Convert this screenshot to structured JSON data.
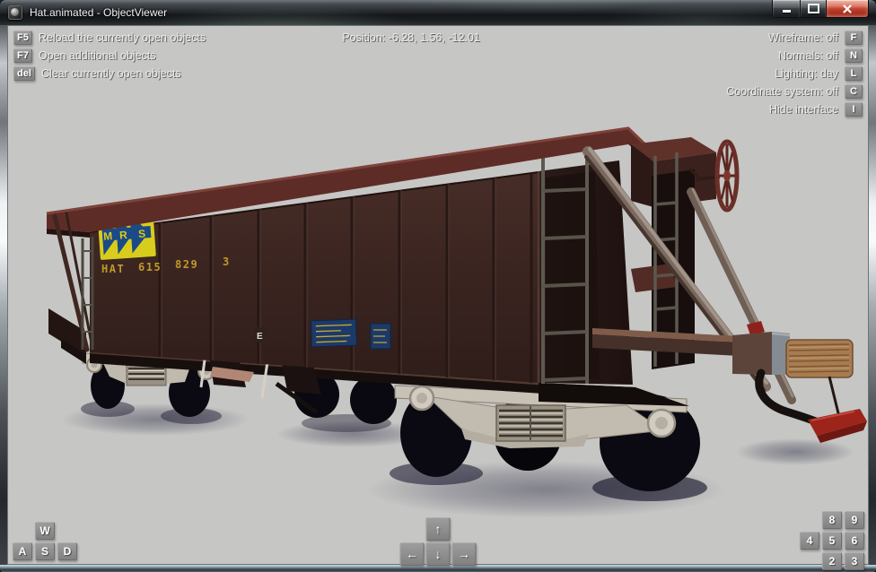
{
  "window": {
    "title": "Hat.animated - ObjectViewer"
  },
  "overlay": {
    "top_left_hints": [
      {
        "key": "F5",
        "label": "Reload the currently open objects"
      },
      {
        "key": "F7",
        "label": "Open additional objects"
      },
      {
        "key": "del",
        "label": "Clear currently open objects"
      }
    ],
    "position_readout": "Position: -6.28, 1.56, -12.01",
    "top_right_hints": [
      {
        "label": "Wireframe: off",
        "key": "F"
      },
      {
        "label": "Normals: off",
        "key": "N"
      },
      {
        "label": "Lighting: day",
        "key": "L"
      },
      {
        "label": "Coordinate system: off",
        "key": "C"
      },
      {
        "label": "Hide interface",
        "key": "I"
      }
    ],
    "move_keys": [
      "W",
      "A",
      "S",
      "D"
    ],
    "arrow_keys": [
      "↑",
      "←",
      "↓",
      "→"
    ],
    "numpad_keys": [
      "8",
      "9",
      "4",
      "5",
      "6",
      "2",
      "3"
    ]
  },
  "model": {
    "logo_letters": [
      "M",
      "R",
      "S"
    ],
    "markings": {
      "class": "HAT",
      "number": "615",
      "serial": "829",
      "check_digit": "3",
      "load_mark": "E"
    }
  },
  "colors": {
    "viewport_bg": "#c6c6c4",
    "wagon_body": "#3a2420",
    "wagon_roof": "#5e2c27",
    "logo_yellow": "#d8cd1d",
    "logo_blue": "#1c4a86",
    "marking_yellow": "#bf9a28",
    "close_button_red": "#c0402f"
  }
}
